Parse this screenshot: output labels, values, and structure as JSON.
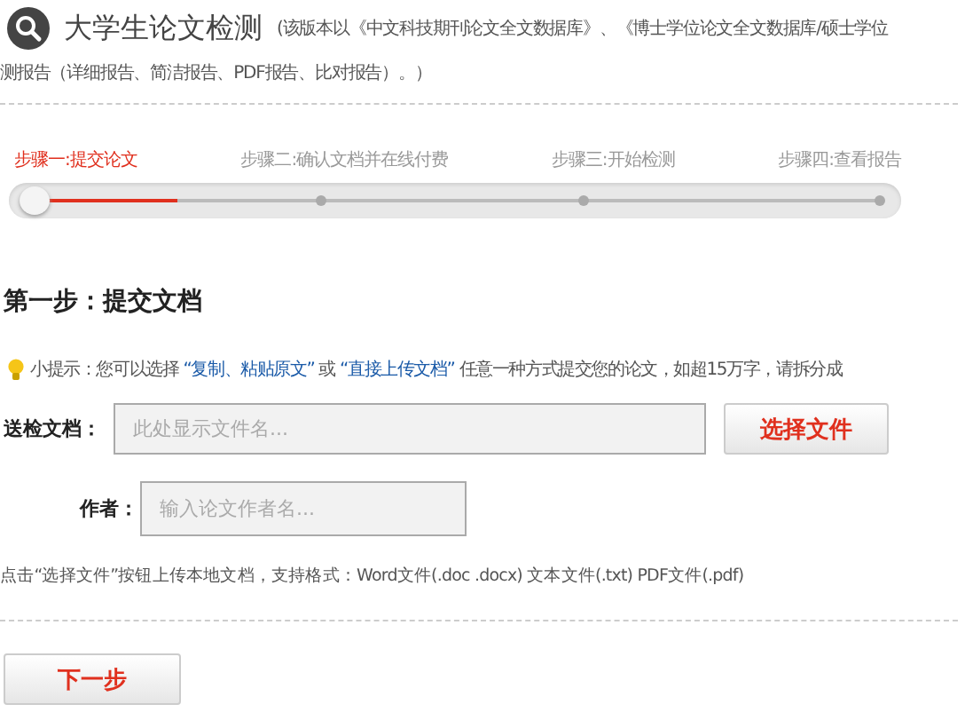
{
  "header": {
    "title": "大学生论文检测",
    "subtitle": "(该版本以《中文科技期刊论文全文数据库》、《博士学位论文全文数据库/硕士学位",
    "subtitle_line2": "测报告（详细报告、简洁报告、PDF报告、比对报告）。）"
  },
  "steps": [
    {
      "label": "步骤一:提交论文",
      "selected": true
    },
    {
      "label": "步骤二:确认文档并在线付费",
      "selected": false
    },
    {
      "label": "步骤三:开始检测",
      "selected": false
    },
    {
      "label": "步骤四:查看报告",
      "selected": false
    }
  ],
  "progress": {
    "level": 0.17
  },
  "section_title": "第一步：提交文档",
  "tip": {
    "before": "小提示：您可以选择 ",
    "link1": "“复制、粘贴原文”",
    "middle": " 或 ",
    "link2": "“直接上传文档”",
    "after": " 任意一种方式提交您的论文，如超15万字，请拆分成"
  },
  "document_field": {
    "label": "送检文档：",
    "placeholder": "此处显示文件名..."
  },
  "choose_button": "选择文件",
  "author_field": {
    "label": "作者：",
    "placeholder": "输入论文作者名..."
  },
  "format_note": "点击“选择文件”按钮上传本地文档，支持格式：Word文件(.doc .docx)   文本文件(.txt)   PDF文件(.pdf)",
  "next_button": "下一步"
}
